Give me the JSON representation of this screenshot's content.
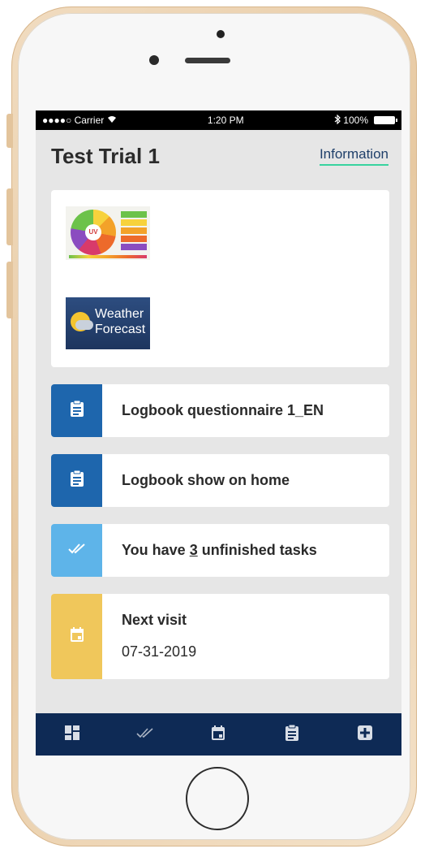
{
  "status_bar": {
    "carrier": "●●●●○ Carrier",
    "time": "1:20 PM",
    "battery": "100%"
  },
  "header": {
    "title": "Test Trial 1",
    "info_link": "Information"
  },
  "images": {
    "uv_label": "UV",
    "weather_label_line1": "Weather",
    "weather_label_line2": "Forecast"
  },
  "cards": [
    {
      "label": "Logbook questionnaire 1_EN",
      "icon": "clipboard-icon",
      "color": "#1e66ad"
    },
    {
      "label": "Logbook show on home",
      "icon": "clipboard-icon",
      "color": "#1e66ad"
    },
    {
      "label_prefix": "You have ",
      "count": "3",
      "label_suffix": " unfinished tasks",
      "icon": "double-check-icon",
      "color": "#5eb4e9"
    }
  ],
  "visit": {
    "title": "Next visit",
    "date": "07-31-2019",
    "icon": "calendar-icon",
    "color": "#f0c75b"
  },
  "bottom_nav": [
    {
      "icon": "dashboard-icon"
    },
    {
      "icon": "double-check-icon"
    },
    {
      "icon": "calendar-icon"
    },
    {
      "icon": "clipboard-icon"
    },
    {
      "icon": "plus-box-icon"
    }
  ],
  "colors": {
    "nav_bg": "#0e2a55",
    "accent_underline": "#38d39f"
  }
}
